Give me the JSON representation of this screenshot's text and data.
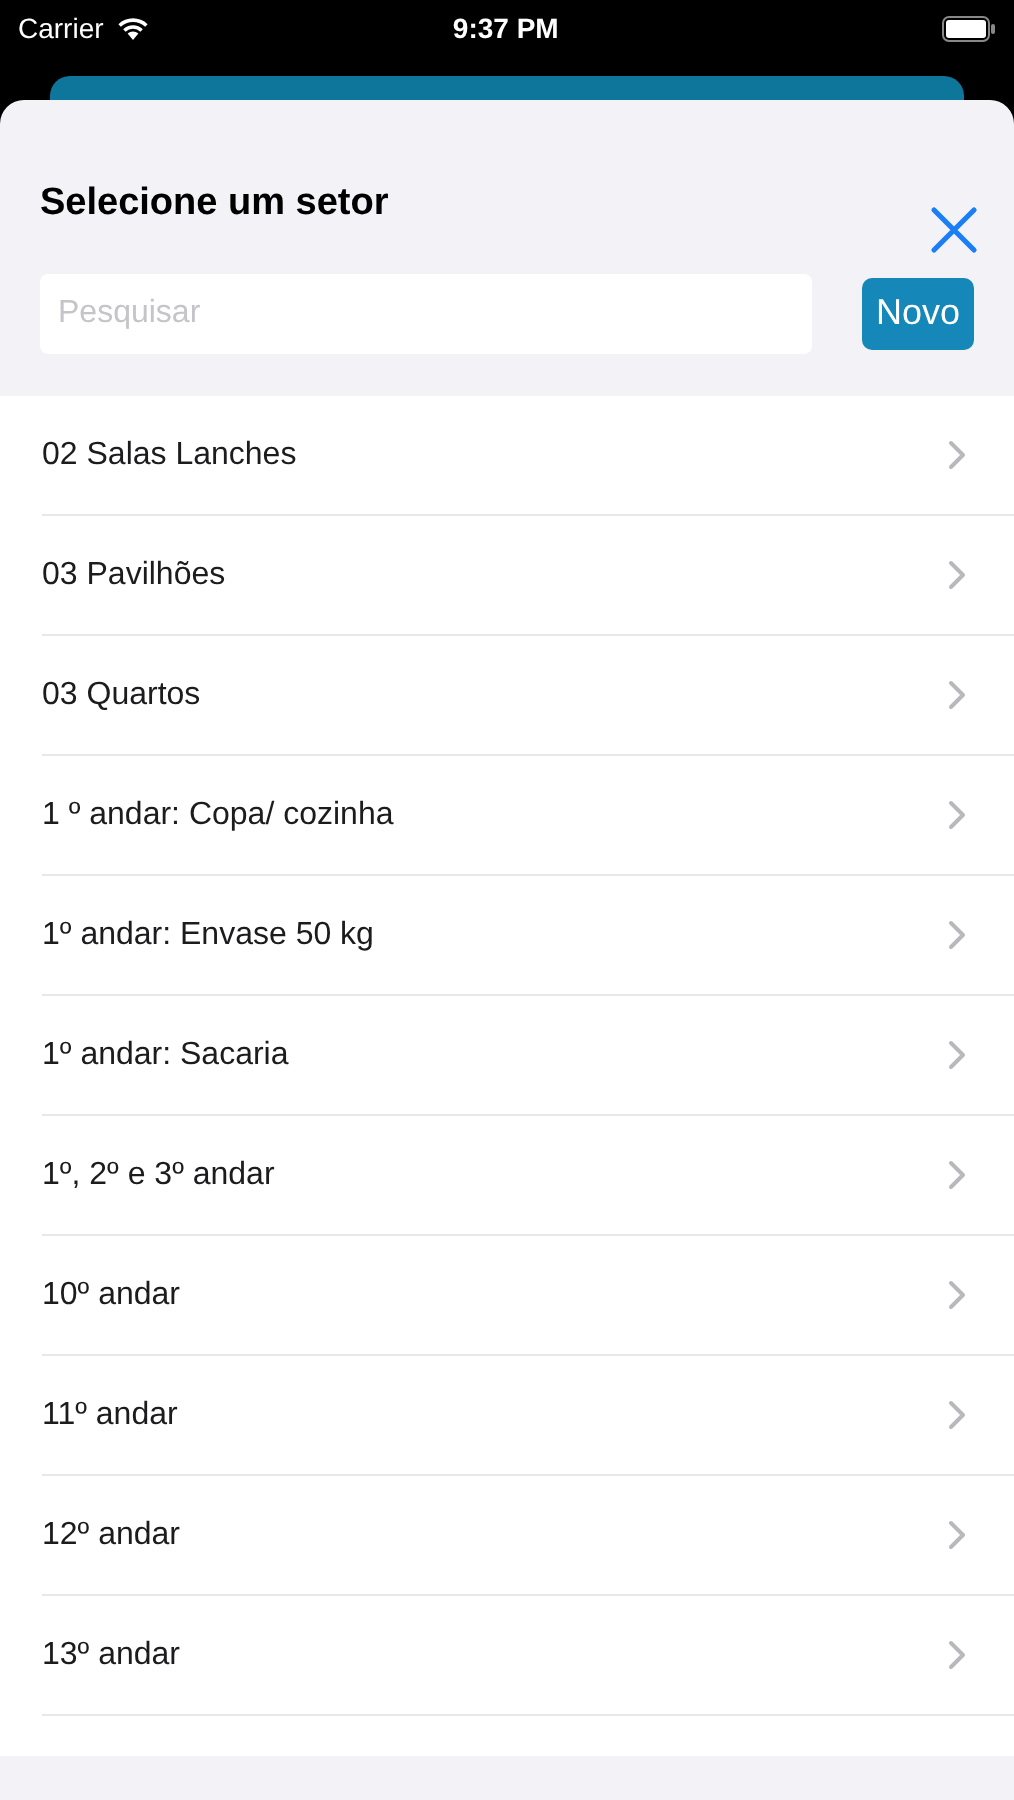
{
  "status_bar": {
    "carrier": "Carrier",
    "time": "9:37 PM"
  },
  "sheet": {
    "title": "Selecione um setor",
    "search": {
      "placeholder": "Pesquisar"
    },
    "new_button": "Novo"
  },
  "items": [
    {
      "label": "02 Salas Lanches"
    },
    {
      "label": "03 Pavilhões"
    },
    {
      "label": "03 Quartos"
    },
    {
      "label": "1 º andar: Copa/ cozinha"
    },
    {
      "label": "1º andar: Envase 50 kg"
    },
    {
      "label": "1º andar: Sacaria"
    },
    {
      "label": "1º, 2º e 3º andar"
    },
    {
      "label": "10º andar"
    },
    {
      "label": "11º andar"
    },
    {
      "label": "12º andar"
    },
    {
      "label": "13º andar"
    }
  ]
}
